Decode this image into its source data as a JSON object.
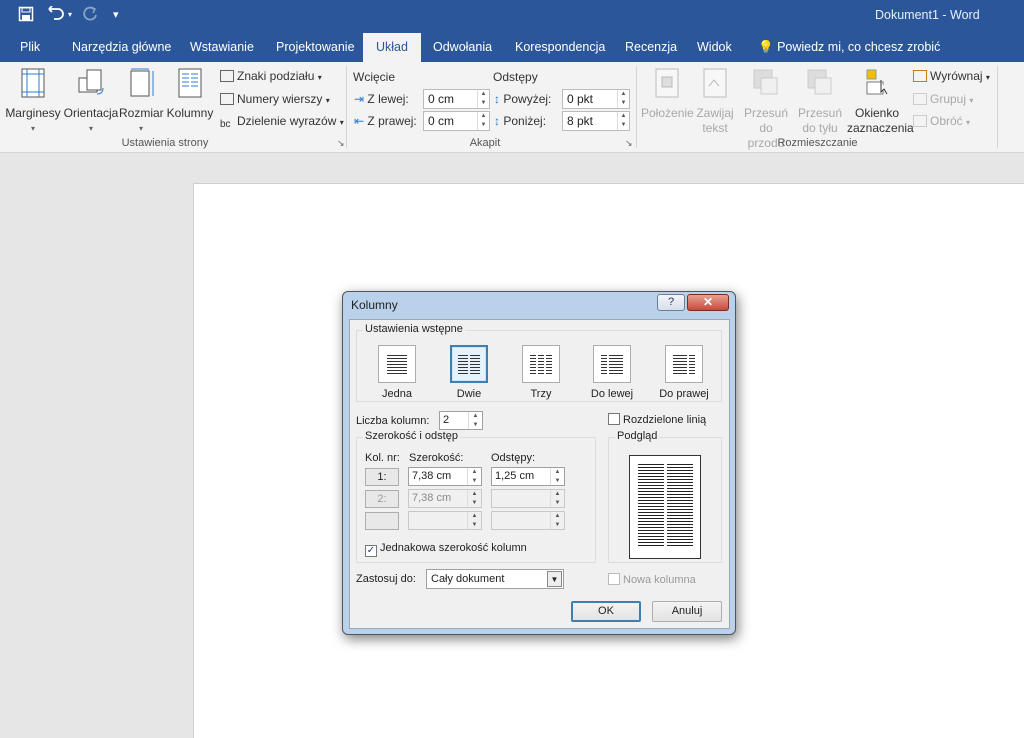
{
  "window": {
    "title": "Dokument1 - Word"
  },
  "qat": {
    "save_icon": "save-icon",
    "undo_icon": "undo-icon",
    "redo_icon": "redo-icon",
    "customize_icon": "customize-qat-icon"
  },
  "tabs": [
    {
      "label": "Plik"
    },
    {
      "label": "Narzędzia główne"
    },
    {
      "label": "Wstawianie"
    },
    {
      "label": "Projektowanie"
    },
    {
      "label": "Układ",
      "active": true
    },
    {
      "label": "Odwołania"
    },
    {
      "label": "Korespondencja"
    },
    {
      "label": "Recenzja"
    },
    {
      "label": "Widok"
    },
    {
      "label": "Powiedz mi, co chcesz zrobić"
    }
  ],
  "ribbon": {
    "page_setup": {
      "label": "Ustawienia strony",
      "margins": "Marginesy",
      "orientation": "Orientacja",
      "size": "Rozmiar",
      "columns": "Kolumny",
      "breaks": "Znaki podziału",
      "line_numbers": "Numery wierszy",
      "hyphenation": "Dzielenie wyrazów"
    },
    "paragraph": {
      "label": "Akapit",
      "indent_label": "Wcięcie",
      "spacing_label": "Odstępy",
      "left_label": "Z lewej:",
      "left_value": "0 cm",
      "right_label": "Z prawej:",
      "right_value": "0 cm",
      "before_label": "Powyżej:",
      "before_value": "0 pkt",
      "after_label": "Poniżej:",
      "after_value": "8 pkt"
    },
    "arrange": {
      "label": "Rozmieszczanie",
      "position": "Położenie",
      "wrap_text_1": "Zawijaj",
      "wrap_text_2": "tekst",
      "bring_forward_1": "Przesuń do",
      "bring_forward_2": "przodu",
      "send_backward_1": "Przesuń",
      "send_backward_2": "do tyłu",
      "selection_pane_1": "Okienko",
      "selection_pane_2": "zaznaczenia",
      "align": "Wyrównaj",
      "group": "Grupuj",
      "rotate": "Obróć"
    }
  },
  "dialog": {
    "title": "Kolumny",
    "help": "?",
    "close": "✕",
    "presets_label": "Ustawienia wstępne",
    "presets": [
      {
        "label": "Jedna"
      },
      {
        "label": "Dwie",
        "selected": true
      },
      {
        "label": "Trzy"
      },
      {
        "label": "Do lewej"
      },
      {
        "label": "Do prawej"
      }
    ],
    "num_columns_label": "Liczba kolumn:",
    "num_columns_value": "2",
    "line_between_label": "Rozdzielone linią",
    "line_between_checked": false,
    "width_spacing_label": "Szerokość i odstęp",
    "col_header": "Kol. nr:",
    "width_header": "Szerokość:",
    "spacing_header": "Odstępy:",
    "rows": [
      {
        "num": "1:",
        "width": "7,38 cm",
        "spacing": "1,25 cm",
        "enabled": true
      },
      {
        "num": "2:",
        "width": "7,38 cm",
        "spacing": "",
        "enabled": false
      },
      {
        "num": "",
        "width": "",
        "spacing": "",
        "enabled": false
      }
    ],
    "equal_width_label": "Jednakowa szerokość kolumn",
    "equal_width_checked": true,
    "preview_label": "Podgląd",
    "apply_to_label": "Zastosuj do:",
    "apply_to_value": "Cały dokument",
    "new_column_label": "Nowa kolumna",
    "ok": "OK",
    "cancel": "Anuluj"
  },
  "colors": {
    "accent": "#2b579a",
    "dialog_frame": "#b9d1ea"
  }
}
